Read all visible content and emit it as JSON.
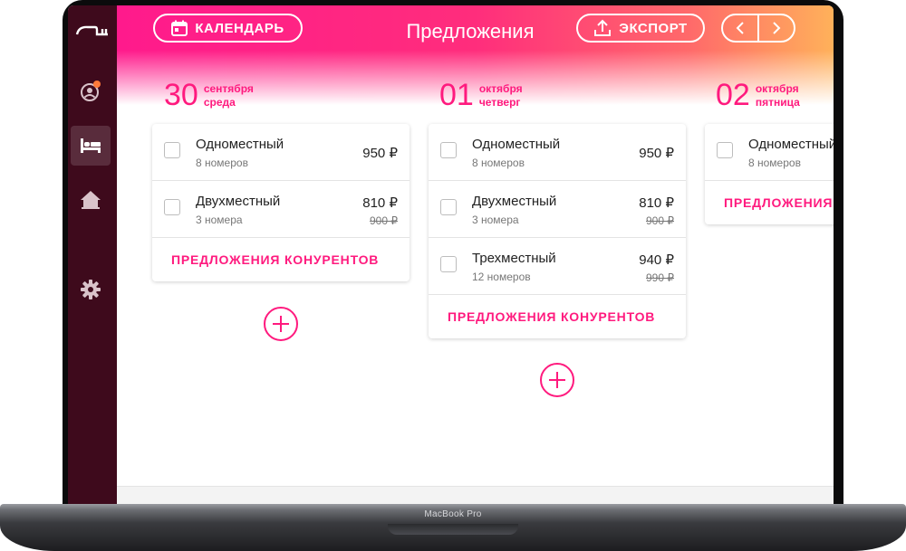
{
  "device": {
    "label": "MacBook Pro"
  },
  "header": {
    "calendar_label": "КАЛЕНДАРЬ",
    "title": "Предложения",
    "export_label": "ЭКСПОРТ"
  },
  "sidebar": {
    "items": [
      {
        "icon": "user-notification-icon",
        "active": false
      },
      {
        "icon": "bed-icon",
        "active": true
      },
      {
        "icon": "home-icon",
        "active": false
      },
      {
        "icon": "gear-icon",
        "active": false
      }
    ]
  },
  "competitors_label": "ПРЕДЛОЖЕНИЯ КОНУРЕНТОВ",
  "days": [
    {
      "num": "30",
      "month": "сентября",
      "weekday": "среда",
      "rooms": [
        {
          "name": "Одноместный",
          "count": "8 номеров",
          "price": "950 ₽",
          "old_price": ""
        },
        {
          "name": "Двухместный",
          "count": "3 номера",
          "price": "810 ₽",
          "old_price": "900 ₽"
        }
      ]
    },
    {
      "num": "01",
      "month": "октября",
      "weekday": "четверг",
      "rooms": [
        {
          "name": "Одноместный",
          "count": "8 номеров",
          "price": "950 ₽",
          "old_price": ""
        },
        {
          "name": "Двухместный",
          "count": "3 номера",
          "price": "810 ₽",
          "old_price": "900 ₽"
        },
        {
          "name": "Трехместный",
          "count": "12 номеров",
          "price": "940 ₽",
          "old_price": "990 ₽"
        }
      ]
    },
    {
      "num": "02",
      "month": "октября",
      "weekday": "пятница",
      "rooms": [
        {
          "name": "Одноместный",
          "count": "8 номеров",
          "price": "",
          "old_price": ""
        }
      ]
    }
  ],
  "colors": {
    "accent": "#ff1a7e",
    "sidebar": "#3e0a1c",
    "gradient_start": "#ff1a8c",
    "gradient_end": "#ffb15a"
  }
}
